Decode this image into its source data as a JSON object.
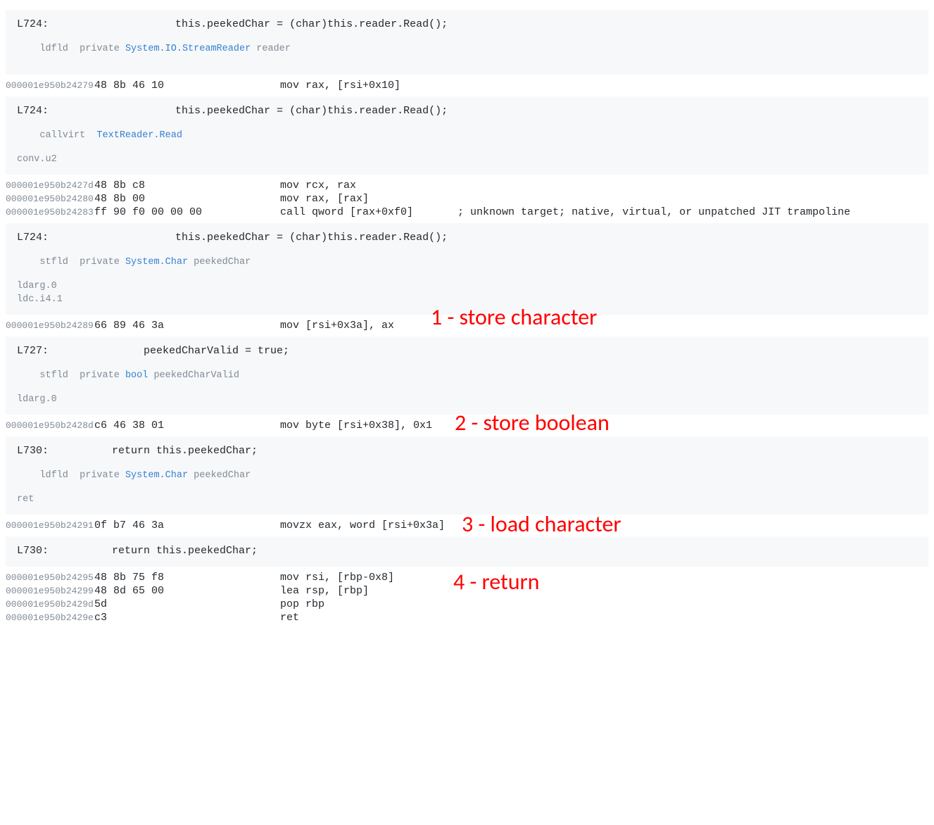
{
  "blocks": {
    "b1": {
      "src": "L724:                    this.peekedChar = (char)this.reader.Read();",
      "il_prefix": "ldfld  private ",
      "il_type": "System.IO.StreamReader",
      "il_suffix": " reader"
    },
    "b2": {
      "src": "L724:                    this.peekedChar = (char)this.reader.Read();",
      "il1_prefix": "callvirt  ",
      "il1_type": "TextReader.Read",
      "il2": "conv.u2"
    },
    "b3": {
      "src": "L724:                    this.peekedChar = (char)this.reader.Read();",
      "il1_prefix": "stfld  private ",
      "il1_type": "System.Char",
      "il1_suffix": " peekedChar",
      "il2": "ldarg.0",
      "il3": "ldc.i4.1"
    },
    "b4": {
      "src": "L727:               peekedCharValid = true;",
      "il1_prefix": "stfld  private ",
      "il1_type": "bool",
      "il1_suffix": " peekedCharValid",
      "il2": "ldarg.0"
    },
    "b5": {
      "src": "L730:          return this.peekedChar;",
      "il1_prefix": "ldfld  private ",
      "il1_type": "System.Char",
      "il1_suffix": " peekedChar",
      "il2": "ret"
    },
    "b6": {
      "src": "L730:          return this.peekedChar;"
    }
  },
  "asm": {
    "r1": {
      "addr": "000001e950b24279",
      "bytes": "48 8b 46 10",
      "instr": "mov rax, [rsi+0x10]"
    },
    "r2": {
      "addr": "000001e950b2427d",
      "bytes": "48 8b c8",
      "instr": "mov rcx, rax"
    },
    "r3": {
      "addr": "000001e950b24280",
      "bytes": "48 8b 00",
      "instr": "mov rax, [rax]"
    },
    "r4": {
      "addr": "000001e950b24283",
      "bytes": "ff 90 f0 00 00 00",
      "instr": "call qword [rax+0xf0]       ; unknown target; native, virtual, or unpatched JIT trampoline"
    },
    "r5": {
      "addr": "000001e950b24289",
      "bytes": "66 89 46 3a",
      "instr": "mov [rsi+0x3a], ax"
    },
    "r6": {
      "addr": "000001e950b2428d",
      "bytes": "c6 46 38 01",
      "instr": "mov byte [rsi+0x38], 0x1"
    },
    "r7": {
      "addr": "000001e950b24291",
      "bytes": "0f b7 46 3a",
      "instr": "movzx eax, word [rsi+0x3a]"
    },
    "r8": {
      "addr": "000001e950b24295",
      "bytes": "48 8b 75 f8",
      "instr": "mov rsi, [rbp-0x8]"
    },
    "r9": {
      "addr": "000001e950b24299",
      "bytes": "48 8d 65 00",
      "instr": "lea rsp, [rbp]"
    },
    "r10": {
      "addr": "000001e950b2429d",
      "bytes": "5d",
      "instr": "pop rbp"
    },
    "r11": {
      "addr": "000001e950b2429e",
      "bytes": "c3",
      "instr": "ret"
    }
  },
  "annotations": {
    "a1": "1 - store character",
    "a2": "2 - store boolean",
    "a3": "3 - load character",
    "a4": "4 - return"
  }
}
